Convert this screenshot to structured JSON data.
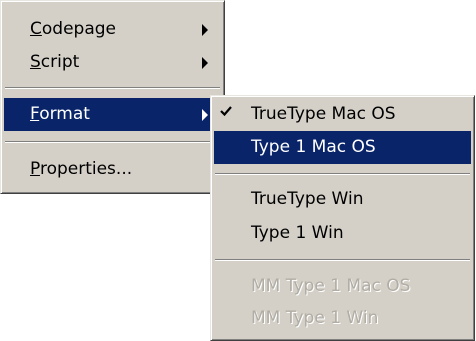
{
  "main_menu": {
    "items": [
      {
        "mnemonic": "C",
        "rest": "odepage",
        "has_submenu": true
      },
      {
        "mnemonic": "S",
        "rest": "cript",
        "has_submenu": true
      },
      {
        "mnemonic": "F",
        "rest": "ormat",
        "has_submenu": true,
        "highlighted": true
      },
      {
        "mnemonic": "P",
        "rest": "roperties...",
        "has_submenu": false
      }
    ]
  },
  "format_submenu": {
    "items": [
      {
        "label": "TrueType Mac OS",
        "checked": true
      },
      {
        "label": "Type 1 Mac OS",
        "highlighted": true
      },
      {
        "label": "TrueType Win"
      },
      {
        "label": "Type 1 Win"
      },
      {
        "label": "MM Type 1 Mac OS",
        "disabled": true
      },
      {
        "label": "MM Type 1 Win",
        "disabled": true
      }
    ]
  },
  "icons": {
    "submenu_arrow": "chevron-right-icon",
    "check": "check-icon"
  },
  "colors": {
    "menu_face": "#d4d0c8",
    "highlight": "#0a246a",
    "highlight_text": "#ffffff",
    "disabled_text": "#b0ada4"
  }
}
